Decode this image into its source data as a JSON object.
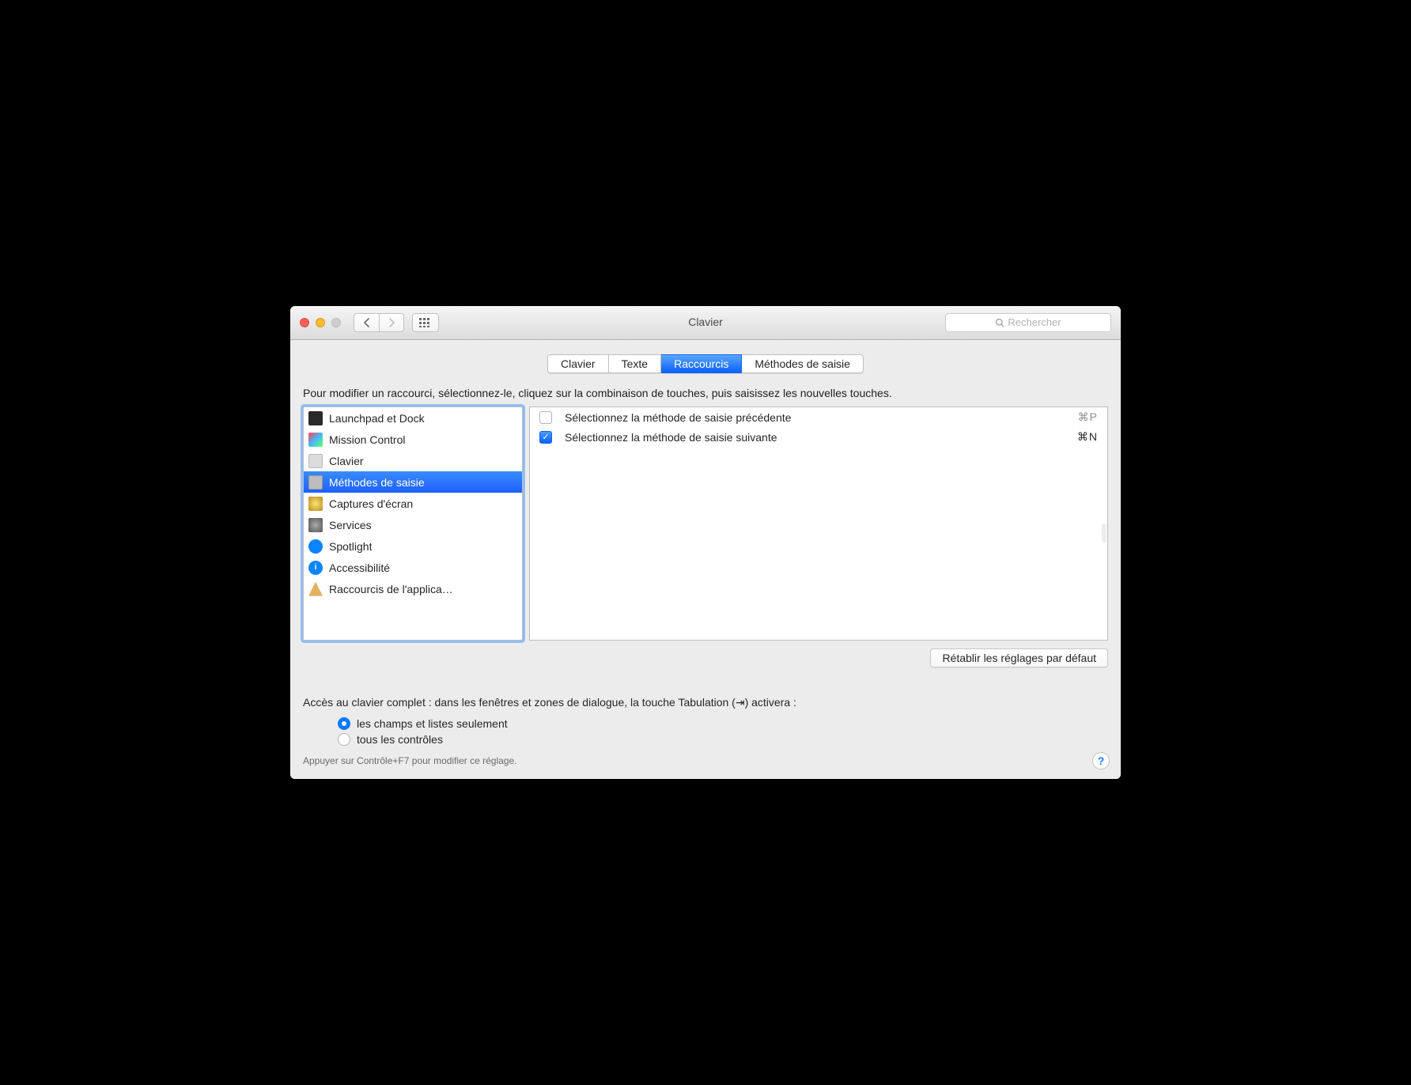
{
  "window": {
    "title": "Clavier",
    "search_placeholder": "Rechercher"
  },
  "tabs": [
    {
      "label": "Clavier",
      "active": false
    },
    {
      "label": "Texte",
      "active": false
    },
    {
      "label": "Raccourcis",
      "active": true
    },
    {
      "label": "Méthodes de saisie",
      "active": false
    }
  ],
  "instructions": "Pour modifier un raccourci, sélectionnez-le, cliquez sur la combinaison de touches, puis saisissez les nouvelles touches.",
  "sidebar": [
    {
      "label": "Launchpad et Dock",
      "icon": "ic-launchpad"
    },
    {
      "label": "Mission Control",
      "icon": "ic-mission"
    },
    {
      "label": "Clavier",
      "icon": "ic-keyboard"
    },
    {
      "label": "Méthodes de saisie",
      "icon": "ic-input",
      "selected": true
    },
    {
      "label": "Captures d'écran",
      "icon": "ic-screenshot"
    },
    {
      "label": "Services",
      "icon": "ic-services"
    },
    {
      "label": "Spotlight",
      "icon": "ic-spotlight"
    },
    {
      "label": "Accessibilité",
      "icon": "ic-access"
    },
    {
      "label": "Raccourcis de l'applica…",
      "icon": "ic-app"
    }
  ],
  "shortcuts": [
    {
      "enabled": false,
      "label": "Sélectionnez la méthode de saisie précédente",
      "keys": "⌘P"
    },
    {
      "enabled": true,
      "label": "Sélectionnez la méthode de saisie suivante",
      "keys": "⌘N"
    }
  ],
  "restore_defaults": "Rétablir les réglages par défaut",
  "full_access": {
    "heading": "Accès au clavier complet : dans les fenêtres et zones de dialogue, la touche Tabulation (⇥) activera :",
    "options": [
      {
        "label": "les champs et listes seulement",
        "selected": true
      },
      {
        "label": "tous les contrôles",
        "selected": false
      }
    ],
    "hint": "Appuyer sur Contrôle+F7 pour modifier ce réglage."
  },
  "help_label": "?"
}
